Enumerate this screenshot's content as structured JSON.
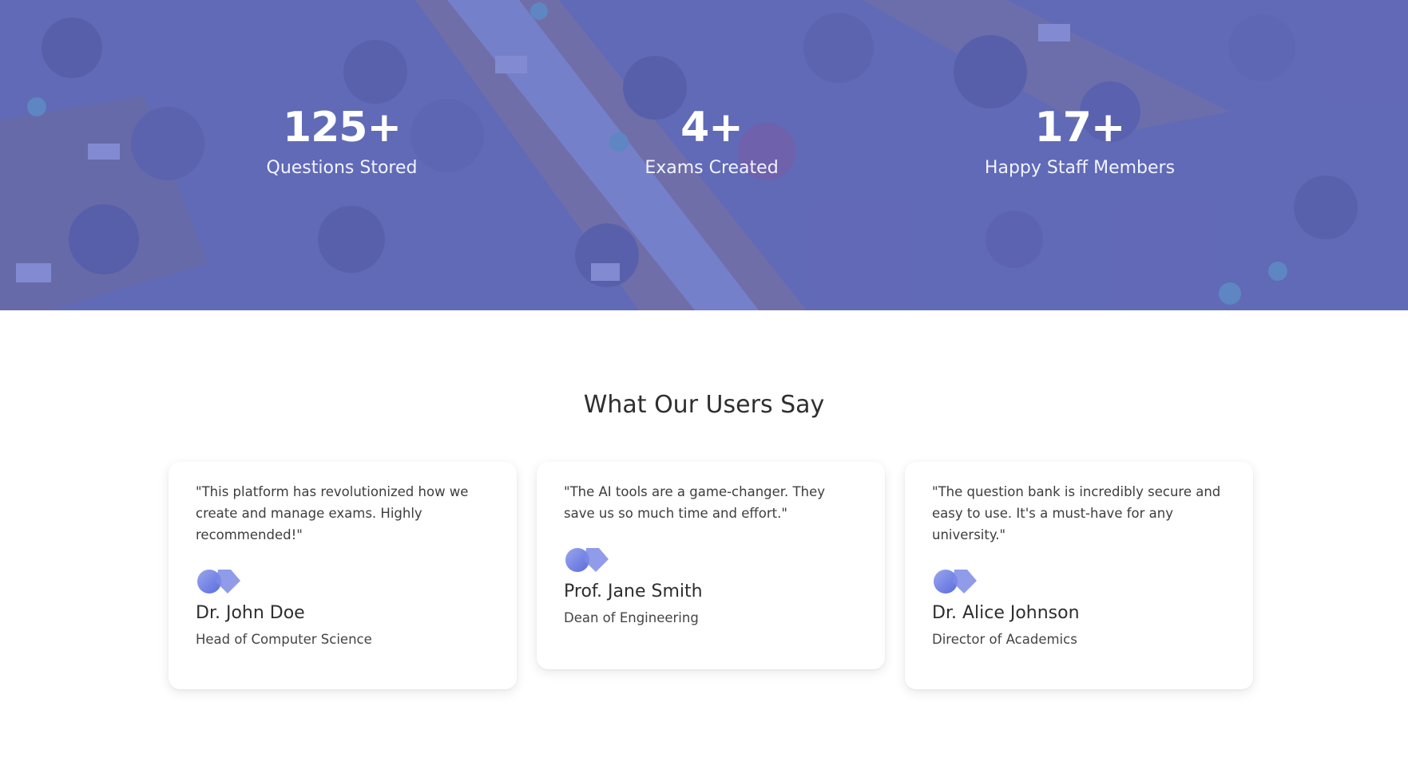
{
  "stats": [
    {
      "value": "125+",
      "label": "Questions Stored"
    },
    {
      "value": "4+",
      "label": "Exams Created"
    },
    {
      "value": "17+",
      "label": "Happy Staff Members"
    }
  ],
  "testimonials_section": {
    "title": "What Our Users Say",
    "items": [
      {
        "quote": "\"This platform has revolutionized how we create and manage exams. Highly recommended!\"",
        "name": "Dr. John Doe",
        "role": "Head of Computer Science",
        "avatar_icon": "user-avatar-icon"
      },
      {
        "quote": "\"The AI tools are a game-changer. They save us so much time and effort.\"",
        "name": "Prof. Jane Smith",
        "role": "Dean of Engineering",
        "avatar_icon": "user-avatar-icon"
      },
      {
        "quote": "\"The question bank is incredibly secure and easy to use. It's a must-have for any university.\"",
        "name": "Dr. Alice Johnson",
        "role": "Director of Academics",
        "avatar_icon": "user-avatar-icon"
      }
    ]
  },
  "colors": {
    "overlay": "#6470d0",
    "avatar": "#6f80e6",
    "title_text": "#2f2f2f",
    "card_bg": "#ffffff"
  }
}
